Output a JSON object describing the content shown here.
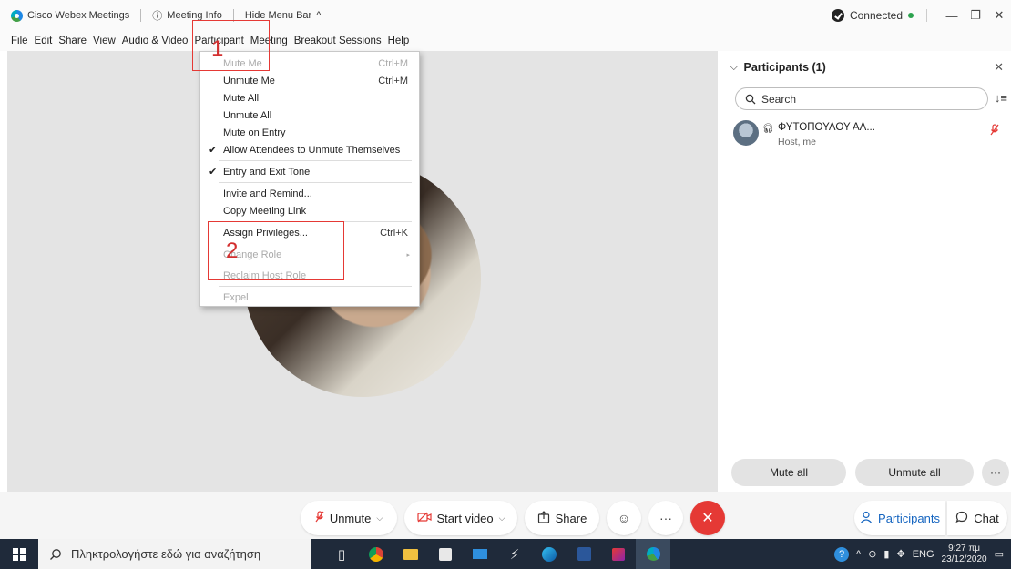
{
  "titlebar": {
    "app_name": "Cisco Webex Meetings",
    "meeting_info": "Meeting Info",
    "hide_menu": "Hide Menu Bar",
    "status": "Connected",
    "minimize": "—",
    "restore": "❐",
    "close": "✕"
  },
  "menu": {
    "items": [
      "File",
      "Edit",
      "Share",
      "View",
      "Audio & Video",
      "Participant",
      "Meeting",
      "Breakout Sessions",
      "Help"
    ]
  },
  "dropdown": {
    "items": [
      {
        "label": "Mute Me",
        "shortcut": "Ctrl+M",
        "disabled": true
      },
      {
        "label": "Unmute Me",
        "shortcut": "Ctrl+M"
      },
      {
        "label": "Mute All"
      },
      {
        "label": "Unmute All"
      },
      {
        "label": "Mute on Entry"
      },
      {
        "label": "Allow Attendees to Unmute Themselves",
        "checked": true
      },
      {
        "label": "Entry and Exit Tone",
        "checked": true
      },
      {
        "label": "Invite and Remind..."
      },
      {
        "label": "Copy Meeting Link"
      },
      {
        "label": "Assign Privileges...",
        "shortcut": "Ctrl+K"
      },
      {
        "label": "Change Role",
        "disabled": true,
        "submenu": true
      },
      {
        "label": "Reclaim Host Role",
        "disabled": true
      },
      {
        "label": "Expel",
        "disabled": true
      }
    ],
    "check_mark": "✔",
    "submenu_arrow": "▸"
  },
  "annotations": {
    "box1_number": "1",
    "box2_number": "2"
  },
  "participants_panel": {
    "title": "Participants (1)",
    "collapse_icon": "⌵",
    "close": "✕",
    "search_placeholder": "Search",
    "sort_icon": "↓≡",
    "participant": {
      "name": "ΦΥΤΟΠΟΥΛΟΥ ΑΛ...",
      "role": "Host, me",
      "mic_icon": "🎙"
    },
    "mute_all": "Mute all",
    "unmute_all": "Unmute all",
    "more": "···"
  },
  "controls": {
    "unmute": "Unmute",
    "start_video": "Start video",
    "share": "Share",
    "reactions": "☺",
    "more": "···",
    "end": "✕",
    "participants": "Participants",
    "chat": "Chat"
  },
  "taskbar": {
    "search_placeholder": "Πληκτρολογήστε εδώ για αναζήτηση",
    "lang": "ENG",
    "time": "9:27 πμ",
    "date": "23/12/2020"
  },
  "colors": {
    "accent_red": "#e53935",
    "connected_green": "#2ca24e",
    "taskbar_bg": "#1f2a3a"
  }
}
